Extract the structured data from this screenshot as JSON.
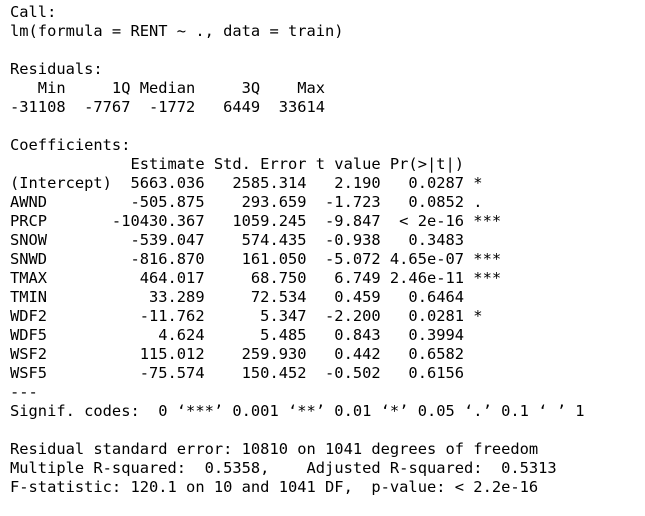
{
  "console": {
    "call": {
      "header": "Call:",
      "formula": "lm(formula = RENT ~ ., data = train)"
    },
    "residuals": {
      "header": "Residuals:",
      "labels": "   Min     1Q Median     3Q    Max ",
      "values": "-31108  -7767  -1772   6449  33614 "
    },
    "coefficients": {
      "header": "Coefficients:",
      "column_header": "             Estimate Std. Error t value Pr(>|t|)    ",
      "rows": [
        "(Intercept)  5663.036   2585.314   2.190   0.0287 *  ",
        "AWND         -505.875    293.659  -1.723   0.0852 .  ",
        "PRCP       -10430.367   1059.245  -9.847  < 2e-16 ***",
        "SNOW         -539.047    574.435  -0.938   0.3483    ",
        "SNWD         -816.870    161.050  -5.072 4.65e-07 ***",
        "TMAX          464.017     68.750   6.749 2.46e-11 ***",
        "TMIN           33.289     72.534   0.459   0.6464    ",
        "WDF2          -11.762      5.347  -2.200   0.0281 *  ",
        "WDF5            4.624      5.485   0.843   0.3994    ",
        "WSF2          115.012    259.930   0.442   0.6582    ",
        "WSF5          -75.574    150.452  -0.502   0.6156    "
      ],
      "separator": "---",
      "signif_codes": "Signif. codes:  0 ‘***’ 0.001 ‘**’ 0.01 ‘*’ 0.05 ‘.’ 0.1 ‘ ’ 1"
    },
    "footer": {
      "residual_se": "Residual standard error: 10810 on 1041 degrees of freedom",
      "r_squared": "Multiple R-squared:  0.5358,\tAdjusted R-squared:  0.5313 ",
      "f_statistic": "F-statistic: 120.1 on 10 and 1041 DF,  p-value: < 2.2e-16"
    }
  }
}
